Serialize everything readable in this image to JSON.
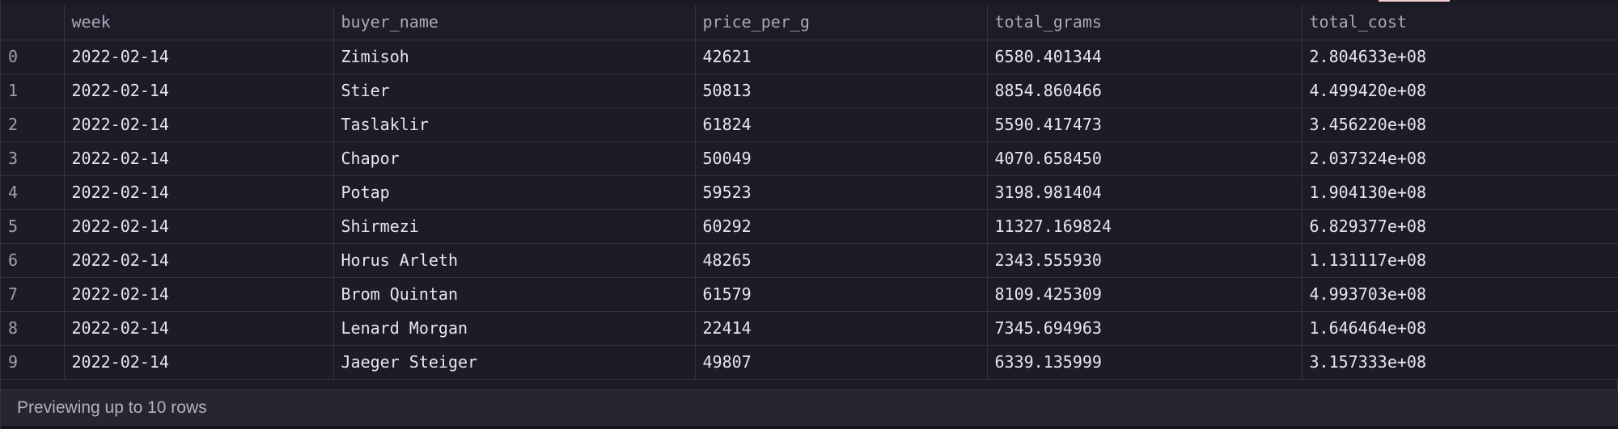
{
  "table": {
    "columns": [
      "",
      "week",
      "buyer_name",
      "price_per_g",
      "total_grams",
      "total_cost"
    ],
    "rows": [
      [
        "0",
        "2022-02-14",
        "Zimisoh",
        "42621",
        "6580.401344",
        "2.804633e+08"
      ],
      [
        "1",
        "2022-02-14",
        "Stier",
        "50813",
        "8854.860466",
        "4.499420e+08"
      ],
      [
        "2",
        "2022-02-14",
        "Taslaklir",
        "61824",
        "5590.417473",
        "3.456220e+08"
      ],
      [
        "3",
        "2022-02-14",
        "Chapor",
        "50049",
        "4070.658450",
        "2.037324e+08"
      ],
      [
        "4",
        "2022-02-14",
        "Potap",
        "59523",
        "3198.981404",
        "1.904130e+08"
      ],
      [
        "5",
        "2022-02-14",
        "Shirmezi",
        "60292",
        "11327.169824",
        "6.829377e+08"
      ],
      [
        "6",
        "2022-02-14",
        "Horus Arleth",
        "48265",
        "2343.555930",
        "1.131117e+08"
      ],
      [
        "7",
        "2022-02-14",
        "Brom Quintan",
        "61579",
        "8109.425309",
        "4.993703e+08"
      ],
      [
        "8",
        "2022-02-14",
        "Lenard Morgan",
        "22414",
        "7345.694963",
        "1.646464e+08"
      ],
      [
        "9",
        "2022-02-14",
        "Jaeger Steiger",
        "49807",
        "6339.135999",
        "3.157333e+08"
      ]
    ]
  },
  "footer": {
    "status_text": "Previewing up to 10 rows"
  },
  "colors": {
    "background": "#1c1c28",
    "grid_line": "#34343f",
    "header_text": "#a9a9b7",
    "cell_text": "#e6e6ee",
    "footer_background": "#262633",
    "accent": "#f3cfd2"
  }
}
